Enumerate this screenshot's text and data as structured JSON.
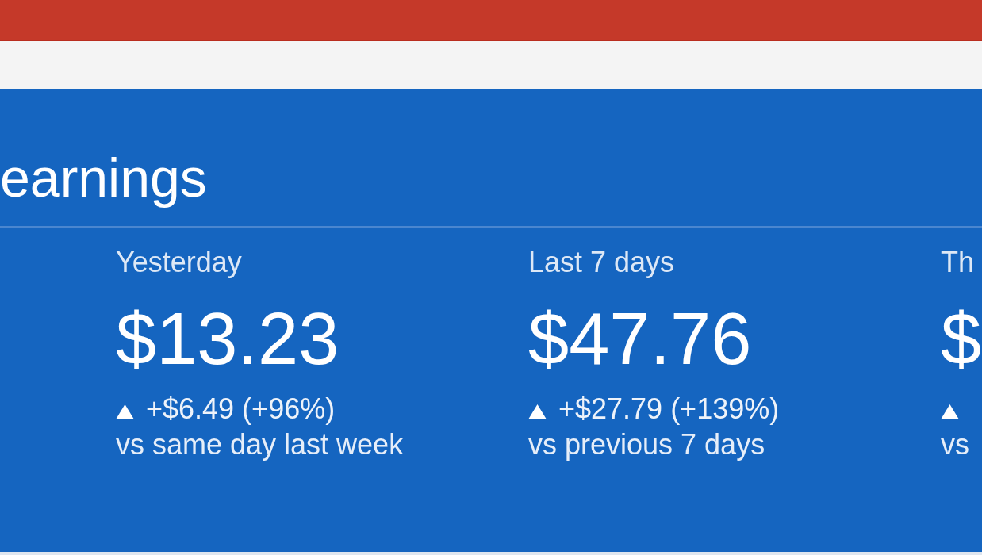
{
  "earnings": {
    "title": "earnings",
    "periods": [
      {
        "label": "Yesterday",
        "amount": "$13.23",
        "increase": true,
        "change": "+$6.49 (+96%)",
        "comparison": "vs same day last week"
      },
      {
        "label": "Last 7 days",
        "amount": "$47.76",
        "increase": true,
        "change": "+$27.79 (+139%)",
        "comparison": "vs previous 7 days"
      },
      {
        "label": "Th",
        "amount": "$",
        "increase": true,
        "comparison": "vs"
      }
    ]
  }
}
